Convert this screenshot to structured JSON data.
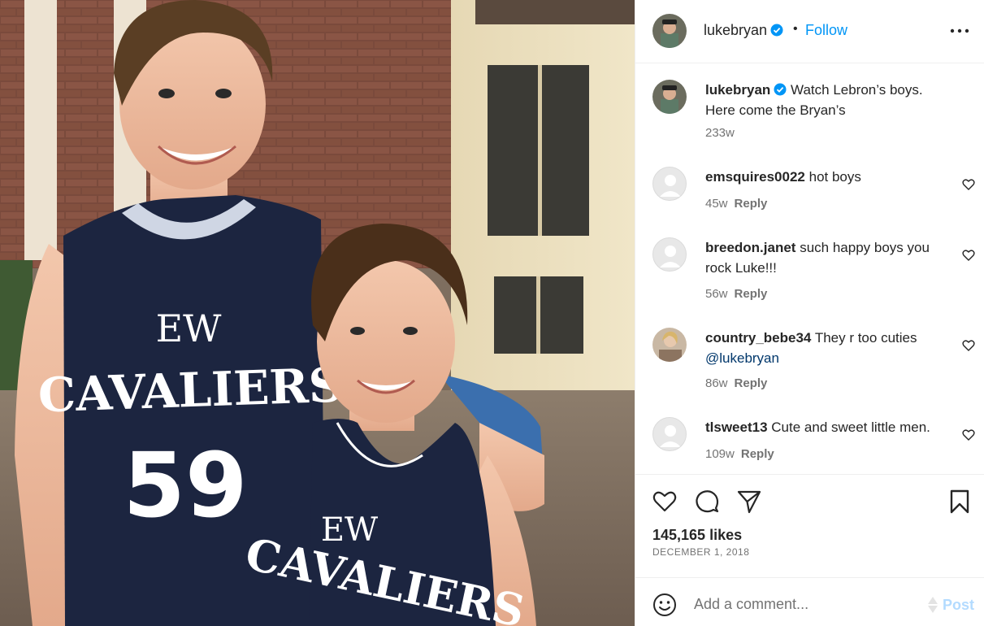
{
  "post": {
    "author": "lukebryan",
    "follow_label": "Follow",
    "separator": "•",
    "more_icon": "more-horizontal-icon"
  },
  "photo": {
    "jersey_letters": "EW",
    "jersey_team": "CAVALIERS",
    "jersey_number": "59"
  },
  "caption": {
    "username": "lukebryan",
    "text": "Watch Lebron’s boys. Here come the Bryan’s",
    "time": "233w"
  },
  "comments": [
    {
      "username": "emsquires0022",
      "text": "hot boys",
      "mention": "",
      "time": "45w",
      "reply_label": "Reply"
    },
    {
      "username": "breedon.janet",
      "text": "such happy boys you rock Luke!!!",
      "mention": "",
      "time": "56w",
      "reply_label": "Reply"
    },
    {
      "username": "country_bebe34",
      "text": "They r too cuties",
      "mention": "@lukebryan",
      "time": "86w",
      "reply_label": "Reply"
    },
    {
      "username": "tlsweet13",
      "text": "Cute and sweet little men.",
      "mention": "",
      "time": "109w",
      "reply_label": "Reply"
    }
  ],
  "actions": {
    "likes": "145,165 likes",
    "date": "DECEMBER 1, 2018"
  },
  "composer": {
    "placeholder": "Add a comment...",
    "post_label": "Post"
  },
  "colors": {
    "accent": "#0095f6",
    "verified": "#0095f6",
    "text": "#262626",
    "secondary": "#737373",
    "jersey_navy": "#1c2540"
  }
}
